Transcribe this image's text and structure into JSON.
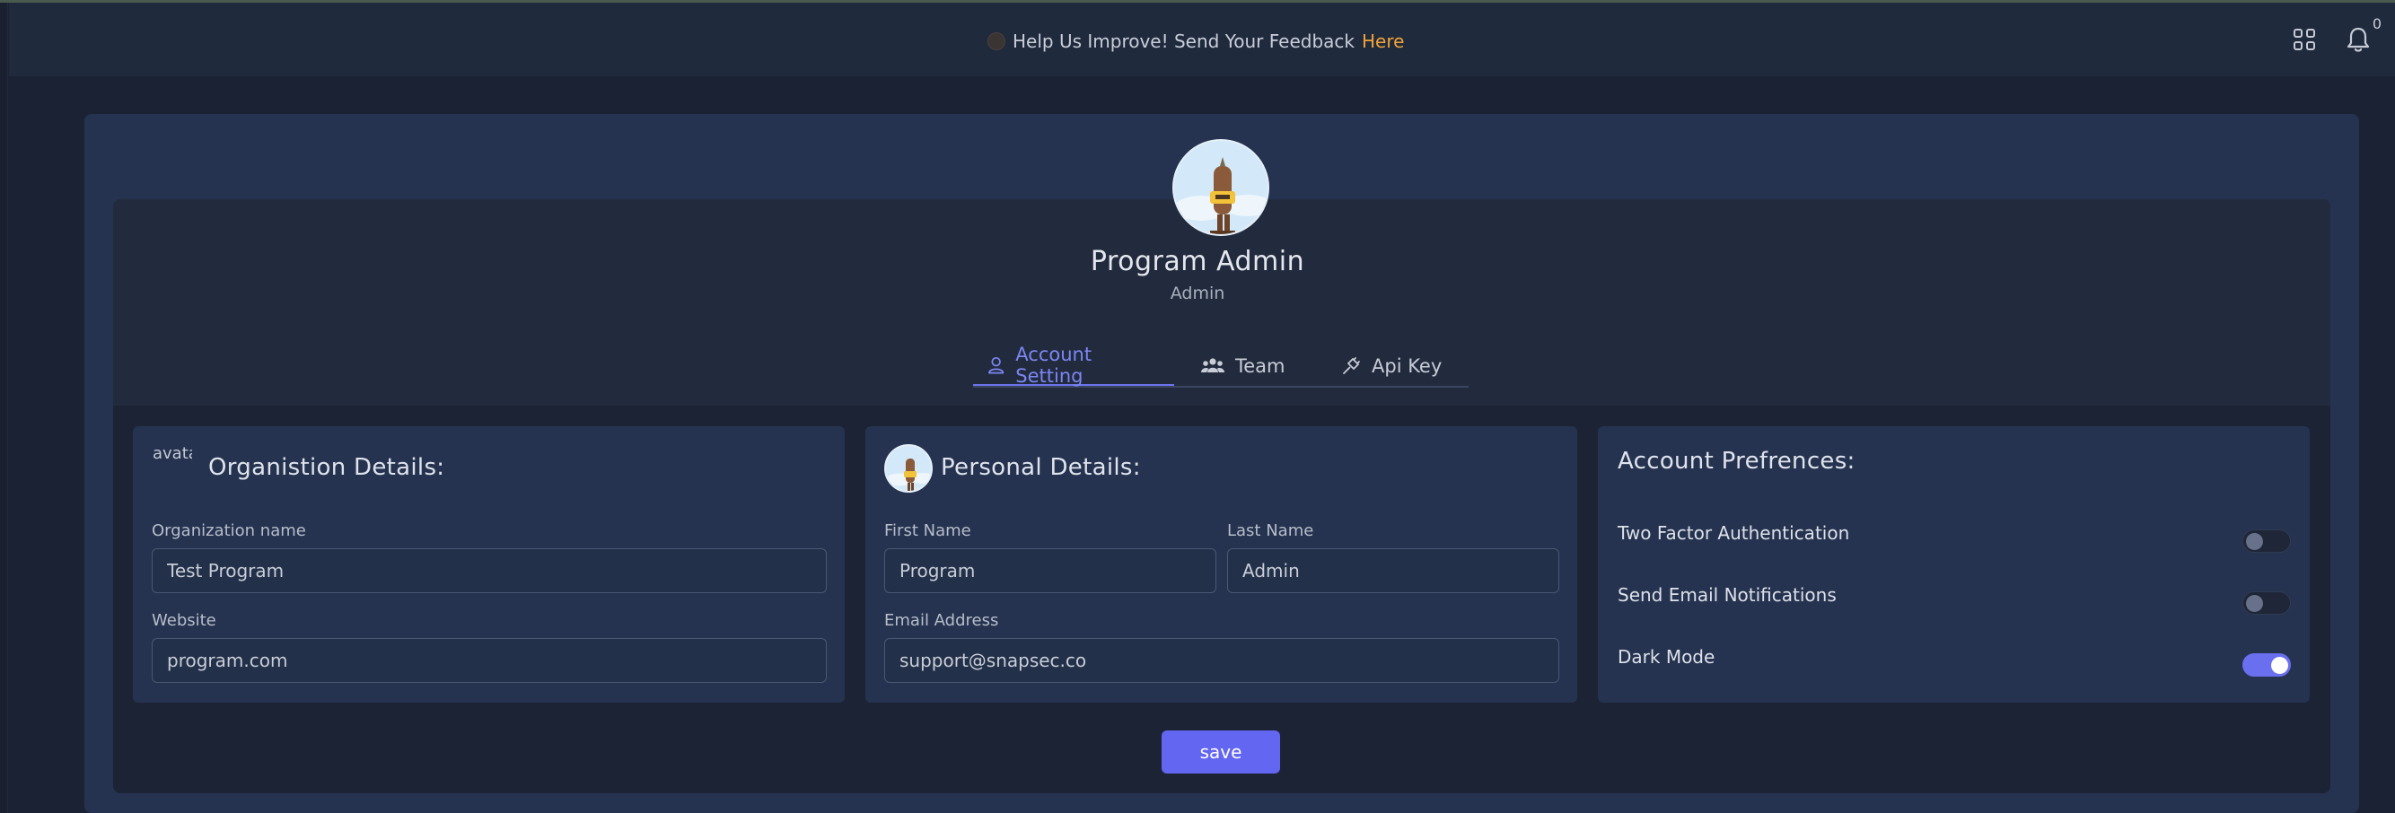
{
  "banner": {
    "text": "Help Us Improve! Send Your Feedback",
    "link": "Here"
  },
  "header": {
    "notification_count": "0",
    "icons": [
      "grid-icon",
      "bell-icon"
    ]
  },
  "profile": {
    "name": "Program Admin",
    "role": "Admin"
  },
  "tabs": [
    {
      "label": "Account Setting",
      "icon": "user-icon",
      "active": true
    },
    {
      "label": "Team",
      "icon": "users-icon",
      "active": false
    },
    {
      "label": "Api Key",
      "icon": "plug-icon",
      "active": false
    }
  ],
  "organization": {
    "title": "Organistion Details:",
    "logo_alt": "avatar",
    "name_label": "Organization name",
    "name_value": "Test Program",
    "website_label": "Website",
    "website_value": "program.com"
  },
  "personal": {
    "title": "Personal Details:",
    "first_name_label": "First Name",
    "first_name_value": "Program",
    "last_name_label": "Last Name",
    "last_name_value": "Admin",
    "email_label": "Email Address",
    "email_value": "support@snapsec.co"
  },
  "preferences": {
    "title": "Account Prefrences:",
    "items": [
      {
        "label": "Two Factor Authentication",
        "enabled": false
      },
      {
        "label": "Send Email Notifications",
        "enabled": false
      },
      {
        "label": "Dark Mode",
        "enabled": true
      }
    ]
  },
  "actions": {
    "save_label": "save"
  },
  "colors": {
    "accent": "#6366f1",
    "link": "#f0a338",
    "background": "#1b2233",
    "card": "#253350"
  }
}
